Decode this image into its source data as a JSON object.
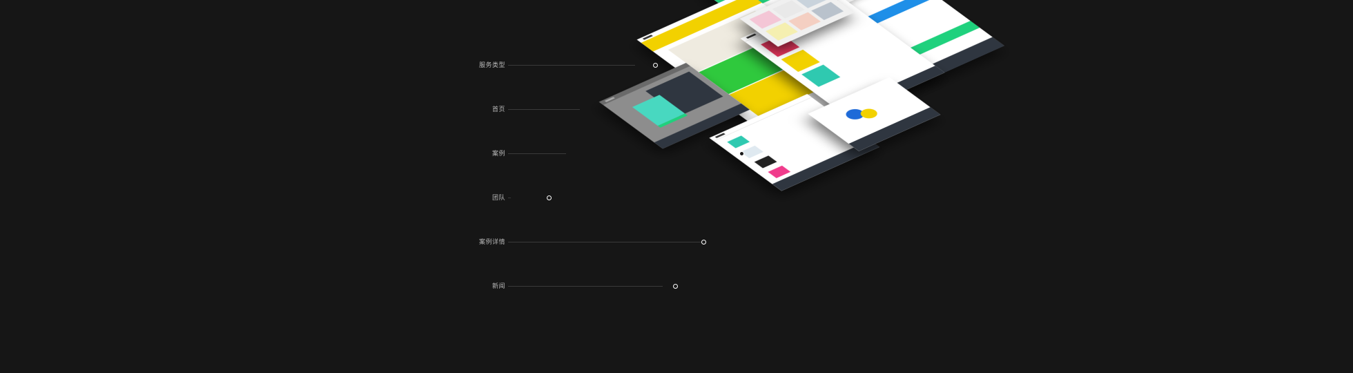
{
  "labels": [
    {
      "text": "服务类型"
    },
    {
      "text": "首页"
    },
    {
      "text": "案例"
    },
    {
      "text": "团队"
    },
    {
      "text": "案例详情"
    },
    {
      "text": "新闻"
    }
  ],
  "colors": {
    "background": "#161616",
    "accent_green": "#1fd17d",
    "accent_yellow": "#f2d100",
    "accent_blue": "#1e8fe8",
    "footer_dark": "#2f3640",
    "line": "#3a3a3a"
  }
}
